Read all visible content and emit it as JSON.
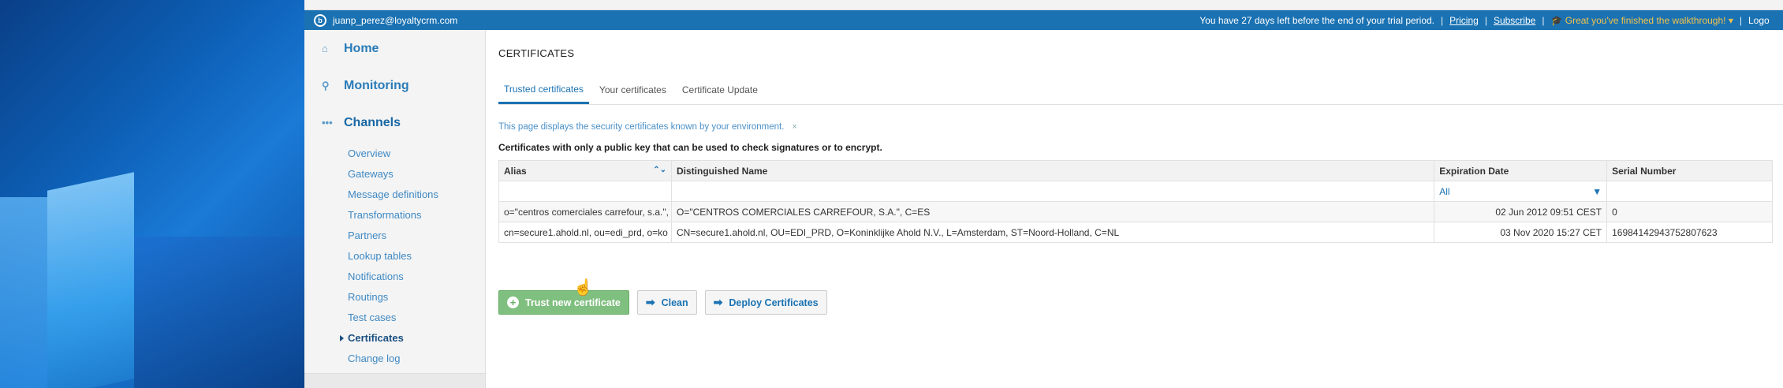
{
  "header": {
    "user": "juanp_perez@loyaltycrm.com",
    "trial_text": "You have 27 days left before the end of your trial period.",
    "pricing": "Pricing",
    "subscribe": "Subscribe",
    "walkthrough": "Great you've finished the walkthrough!",
    "logout": "Logo"
  },
  "sidebar": {
    "home": "Home",
    "monitoring": "Monitoring",
    "channels": "Channels",
    "items": [
      {
        "label": "Overview"
      },
      {
        "label": "Gateways"
      },
      {
        "label": "Message definitions"
      },
      {
        "label": "Transformations"
      },
      {
        "label": "Partners"
      },
      {
        "label": "Lookup tables"
      },
      {
        "label": "Notifications"
      },
      {
        "label": "Routings"
      },
      {
        "label": "Test cases"
      },
      {
        "label": "Certificates"
      },
      {
        "label": "Change log"
      }
    ]
  },
  "main": {
    "title": "CERTIFICATES",
    "tabs": [
      {
        "label": "Trusted certificates"
      },
      {
        "label": "Your certificates"
      },
      {
        "label": "Certificate Update"
      }
    ],
    "info": "This page displays the security certificates known by your environment.",
    "info_close": "×",
    "note": "Certificates with only a public key that can be used to check signatures or to encrypt.",
    "table": {
      "headers": [
        "Alias",
        "Distinguished Name",
        "Expiration Date",
        "Serial Number"
      ],
      "filter_expiration": "All",
      "rows": [
        {
          "alias": "o=\"centros comerciales carrefour, s.a.\",",
          "dn": "O=\"CENTROS COMERCIALES CARREFOUR, S.A.\", C=ES",
          "expiration": "02 Jun 2012 09:51 CEST",
          "serial": "0"
        },
        {
          "alias": "cn=secure1.ahold.nl, ou=edi_prd, o=ko",
          "dn": "CN=secure1.ahold.nl, OU=EDI_PRD, O=Koninklijke Ahold N.V., L=Amsterdam, ST=Noord-Holland, C=NL",
          "expiration": "03 Nov 2020 15:27 CET",
          "serial": "16984142943752807623"
        }
      ]
    },
    "buttons": {
      "trust": "Trust new certificate",
      "clean": "Clean",
      "deploy": "Deploy Certificates"
    }
  }
}
